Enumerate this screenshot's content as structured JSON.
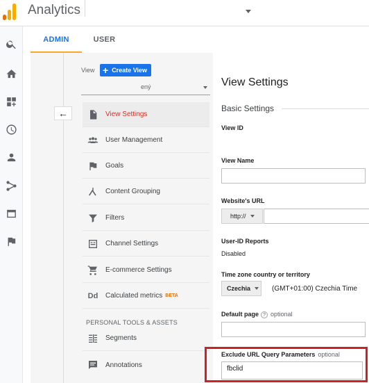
{
  "header": {
    "app_title": "Analytics",
    "logo_colors": [
      "#f9ab00",
      "#e37400",
      "#e37400"
    ]
  },
  "rail": {
    "icons": [
      "search-icon",
      "home-icon",
      "customization-icon",
      "clock-icon",
      "person-icon",
      "acquisition-icon",
      "behavior-icon",
      "flag-icon"
    ]
  },
  "tabs": [
    {
      "label": "ADMIN",
      "active": true
    },
    {
      "label": "USER",
      "active": false
    }
  ],
  "view_column": {
    "label": "View",
    "create_view": "Create View",
    "selected_view": "ený",
    "nav": [
      {
        "label": "View Settings",
        "icon": "document-icon",
        "active": true
      },
      {
        "label": "User Management",
        "icon": "users-icon"
      },
      {
        "label": "Goals",
        "icon": "flag-icon"
      },
      {
        "label": "Content Grouping",
        "icon": "content-grouping-icon"
      },
      {
        "label": "Filters",
        "icon": "filter-icon"
      },
      {
        "label": "Channel Settings",
        "icon": "channel-settings-icon"
      },
      {
        "label": "E-commerce Settings",
        "icon": "cart-icon"
      },
      {
        "label": "Calculated metrics",
        "icon": "dd-icon",
        "badge": "BETA"
      }
    ],
    "section_header": "PERSONAL TOOLS & ASSETS",
    "tools": [
      {
        "label": "Segments",
        "icon": "segments-icon"
      },
      {
        "label": "Annotations",
        "icon": "annotations-icon"
      }
    ]
  },
  "settings": {
    "title": "View Settings",
    "subtitle": "Basic Settings",
    "view_id_label": "View ID",
    "view_name_label": "View Name",
    "view_name_value": "",
    "website_url_label": "Website's URL",
    "protocol": "http://",
    "website_url_value": "",
    "userid_label": "User-ID Reports",
    "userid_value": "Disabled",
    "timezone_label": "Time zone country or territory",
    "timezone_country": "Czechia",
    "timezone_value": "(GMT+01:00) Czechia Time",
    "default_page_label": "Default page",
    "help_glyph": "?",
    "optional_text": "optional",
    "default_page_value": "",
    "exclude_label": "Exclude URL Query Parameters",
    "exclude_value": "fbclid"
  },
  "colors": {
    "accent": "#1a73e8",
    "active_nav": "#d93025",
    "highlight": "#d21f26",
    "tab_underline": "#f9a825"
  }
}
